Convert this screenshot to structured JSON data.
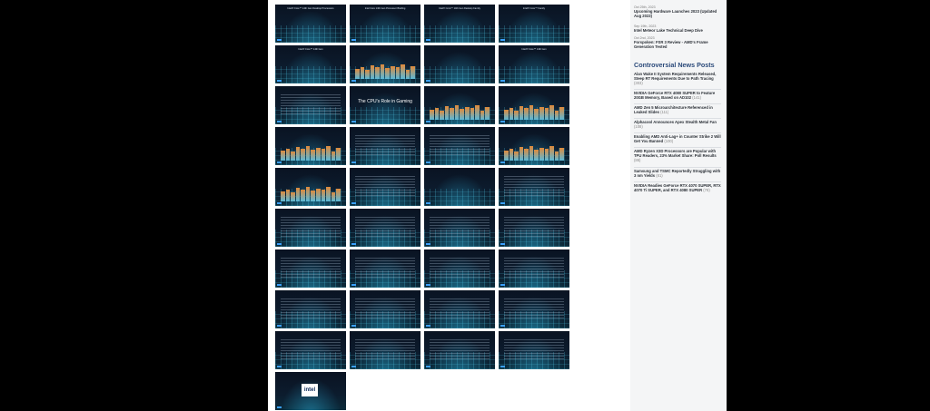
{
  "gallery": {
    "slides": [
      {
        "title": "Intel® Core™ 14th Gen Desktop Processors",
        "kind": "title"
      },
      {
        "title": "Intel Core 14th Gen Processor Briefing",
        "kind": "person"
      },
      {
        "title": "Intel® Core™ 14th Gen Desktop Family",
        "kind": "chips"
      },
      {
        "title": "Intel® Core™ Family",
        "kind": "chip"
      },
      {
        "title": "Intel® Core™ 14th Gen",
        "kind": "chip"
      },
      {
        "title": "",
        "kind": "bars"
      },
      {
        "title": "",
        "kind": "chip"
      },
      {
        "title": "Intel® Core™ 14th Gen",
        "kind": "chip"
      },
      {
        "title": "",
        "kind": "lines"
      },
      {
        "title": "The CPU's Role in Gaming",
        "kind": "big"
      },
      {
        "title": "",
        "kind": "bars"
      },
      {
        "title": "",
        "kind": "bars"
      },
      {
        "title": "",
        "kind": "bars"
      },
      {
        "title": "",
        "kind": "lines"
      },
      {
        "title": "",
        "kind": "lines"
      },
      {
        "title": "",
        "kind": "bars"
      },
      {
        "title": "",
        "kind": "bars"
      },
      {
        "title": "",
        "kind": "lines"
      },
      {
        "title": "",
        "kind": "chips"
      },
      {
        "title": "",
        "kind": "lines"
      },
      {
        "title": "",
        "kind": "lines"
      },
      {
        "title": "",
        "kind": "lines"
      },
      {
        "title": "",
        "kind": "lines"
      },
      {
        "title": "",
        "kind": "lines"
      },
      {
        "title": "",
        "kind": "lines"
      },
      {
        "title": "",
        "kind": "lines"
      },
      {
        "title": "",
        "kind": "lines"
      },
      {
        "title": "",
        "kind": "lines"
      },
      {
        "title": "",
        "kind": "lines"
      },
      {
        "title": "",
        "kind": "lines"
      },
      {
        "title": "",
        "kind": "lines"
      },
      {
        "title": "",
        "kind": "lines"
      },
      {
        "title": "",
        "kind": "lines"
      },
      {
        "title": "",
        "kind": "lines"
      },
      {
        "title": "",
        "kind": "lines"
      },
      {
        "title": "",
        "kind": "lines"
      },
      {
        "title": "intel",
        "kind": "logo"
      }
    ]
  },
  "sidebar": {
    "recent": [
      {
        "date": "Oct 25th, 2023",
        "title": "Upcoming Hardware Launches 2023 (Updated Aug 2023)"
      },
      {
        "date": "Sep 19th, 2023",
        "title": "Intel Meteor Lake Technical Deep Dive"
      },
      {
        "date": "Oct 2nd, 2023",
        "title": "Forspoken: FSR 3 Review - AMD's Frame Generation Tested"
      }
    ],
    "controversial_heading": "Controversial News Posts",
    "controversial": [
      {
        "title": "Alan Wake II System Requirements Released, Steep RT Requirements Due to Path Tracing",
        "count": "(303)"
      },
      {
        "title": "NVIDIA GeForce RTX 4080 SUPER to Feature 20GB Memory, Based on AD102",
        "count": "(141)"
      },
      {
        "title": "AMD Zen 5 Microarchitecture Referenced in Leaked Slides",
        "count": "(111)"
      },
      {
        "title": "Alphacool Announces Apex Stealth Metal Fan",
        "count": "(108)"
      },
      {
        "title": "Enabling AMD Anti-Lag+ in Counter Strike 2 Will Get You Banned",
        "count": "(100)"
      },
      {
        "title": "AMD Ryzen X3D Processors are Popular with TPU Readers, 23% Market Share: Poll Results",
        "count": "(86)"
      },
      {
        "title": "Samsung and TSMC Reportedly Struggling with 3 nm Yields",
        "count": "(81)"
      },
      {
        "title": "NVIDIA Readies GeForce RTX 4070 SUPER, RTX 4070 Ti SUPER, and RTX 4080 SUPER",
        "count": "(78)"
      }
    ]
  }
}
